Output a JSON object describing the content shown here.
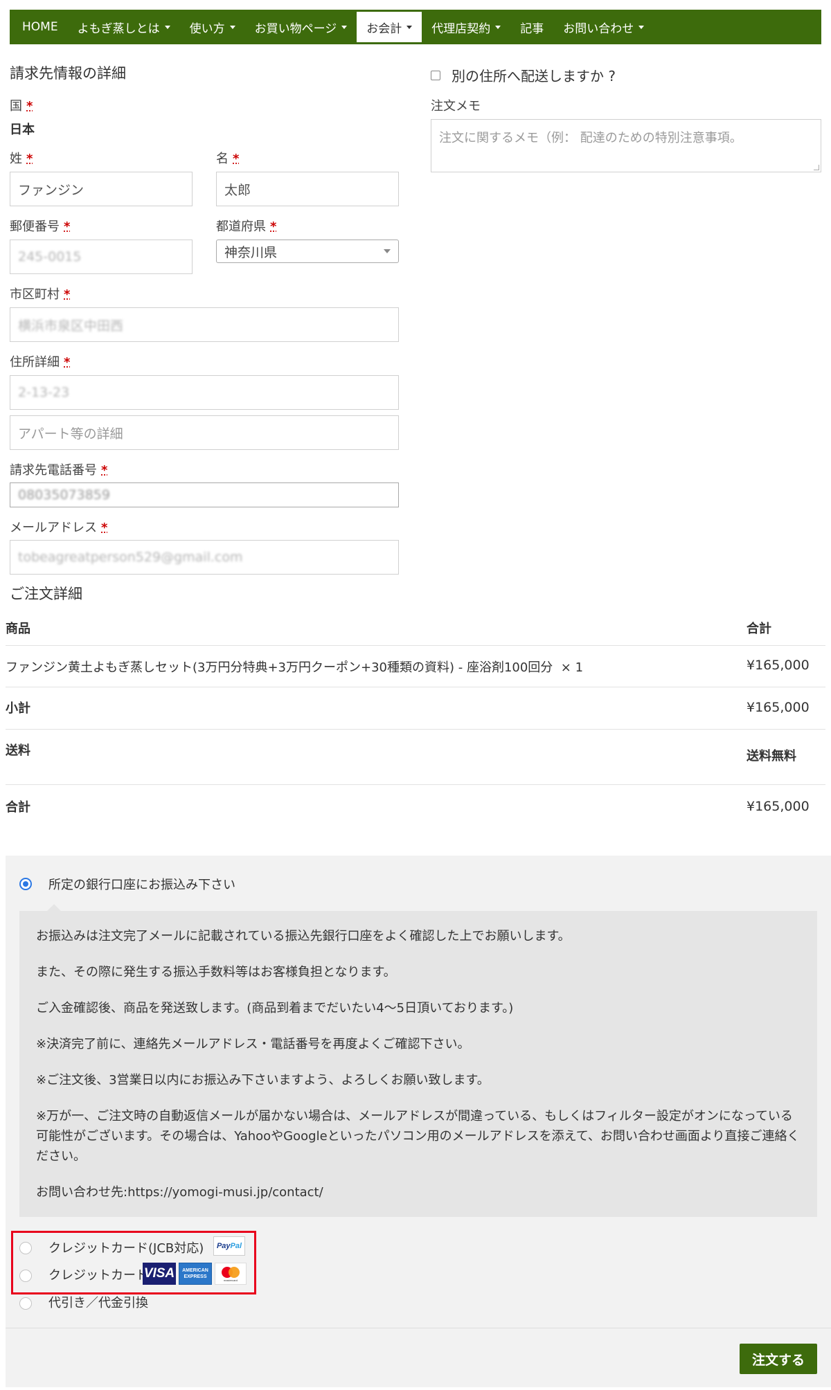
{
  "nav": {
    "items": [
      {
        "label": "HOME",
        "caret": false
      },
      {
        "label": "よもぎ蒸しとは",
        "caret": true
      },
      {
        "label": "使い方",
        "caret": true
      },
      {
        "label": "お買い物ページ",
        "caret": true
      },
      {
        "label": "お会計",
        "caret": true,
        "active": true
      },
      {
        "label": "代理店契約",
        "caret": true
      },
      {
        "label": "記事",
        "caret": false
      },
      {
        "label": "お問い合わせ",
        "caret": true
      }
    ]
  },
  "billing": {
    "heading": "請求先情報の詳細",
    "required_mark": "*",
    "country_label": "国",
    "country_value": "日本",
    "last_name_label": "姓",
    "last_name_value": "ファンジン",
    "first_name_label": "名",
    "first_name_value": "太郎",
    "postcode_label": "郵便番号",
    "postcode_value": "245-0015",
    "prefecture_label": "都道府県",
    "prefecture_value": "神奈川県",
    "city_label": "市区町村",
    "city_value": "横浜市泉区中田西",
    "address_label": "住所詳細",
    "address_value": "2-13-23",
    "address2_placeholder": "アパート等の詳細",
    "phone_label": "請求先電話番号",
    "phone_value": "08035073859",
    "email_label": "メールアドレス",
    "email_value": "tobeagreatperson529@gmail.com"
  },
  "shipping": {
    "ship_diff_label": "別の住所へ配送しますか ?",
    "notes_label": "注文メモ",
    "notes_placeholder": "注文に関するメモ（例： 配達のための特別注意事項。"
  },
  "order": {
    "heading": "ご注文詳細",
    "col_product": "商品",
    "col_total": "合計",
    "item_name": "ファンジン黄土よもぎ蒸しセット(3万円分特典+3万円クーポン+30種類の資料) - 座浴剤100回分",
    "item_qty": "× 1",
    "item_total": "¥165,000",
    "subtotal_label": "小計",
    "subtotal_value": "¥165,000",
    "shipping_label": "送料",
    "shipping_value": "送料無料",
    "total_label": "合計",
    "total_value": "¥165,000"
  },
  "payment": {
    "bank_label": "所定の銀行口座にお振込み下さい",
    "bank_desc": [
      "お振込みは注文完了メールに記載されている振込先銀行口座をよく確認した上でお願いします。",
      "また、その際に発生する振込手数料等はお客様負担となります。",
      "ご入金確認後、商品を発送致します。(商品到着までだいたい4～5日頂いております。)",
      "※決済完了前に、連絡先メールアドレス・電話番号を再度よくご確認下さい。",
      "※ご注文後、3営業日以内にお振込み下さいますよう、よろしくお願い致します。",
      "※万が一、ご注文時の自動返信メールが届かない場合は、メールアドレスが間違っている、もしくはフィルター設定がオンになっている可能性がございます。その場合は、YahooやGoogleといったパソコン用のメールアドレスを添えて、お問い合わせ画面より直接ご連絡ください。",
      "お問い合わせ先:https://yomogi-musi.jp/contact/"
    ],
    "paypal_label": "クレジットカード(JCB対応)",
    "card_label": "クレジットカード",
    "cod_label": "代引き／代金引換",
    "logos": {
      "paypal_a": "Pay",
      "paypal_b": "Pal",
      "visa": "VISA",
      "amex": "AMERICAN EXPRESS",
      "mastercard": "mastercard"
    },
    "submit_label": "注文する"
  },
  "colors": {
    "nav_bg": "#3d6b0c",
    "button_bg": "#3d6b0c",
    "required": "#cc0000",
    "highlight_box": "#e8001c",
    "radio_checked": "#2b78e4"
  }
}
